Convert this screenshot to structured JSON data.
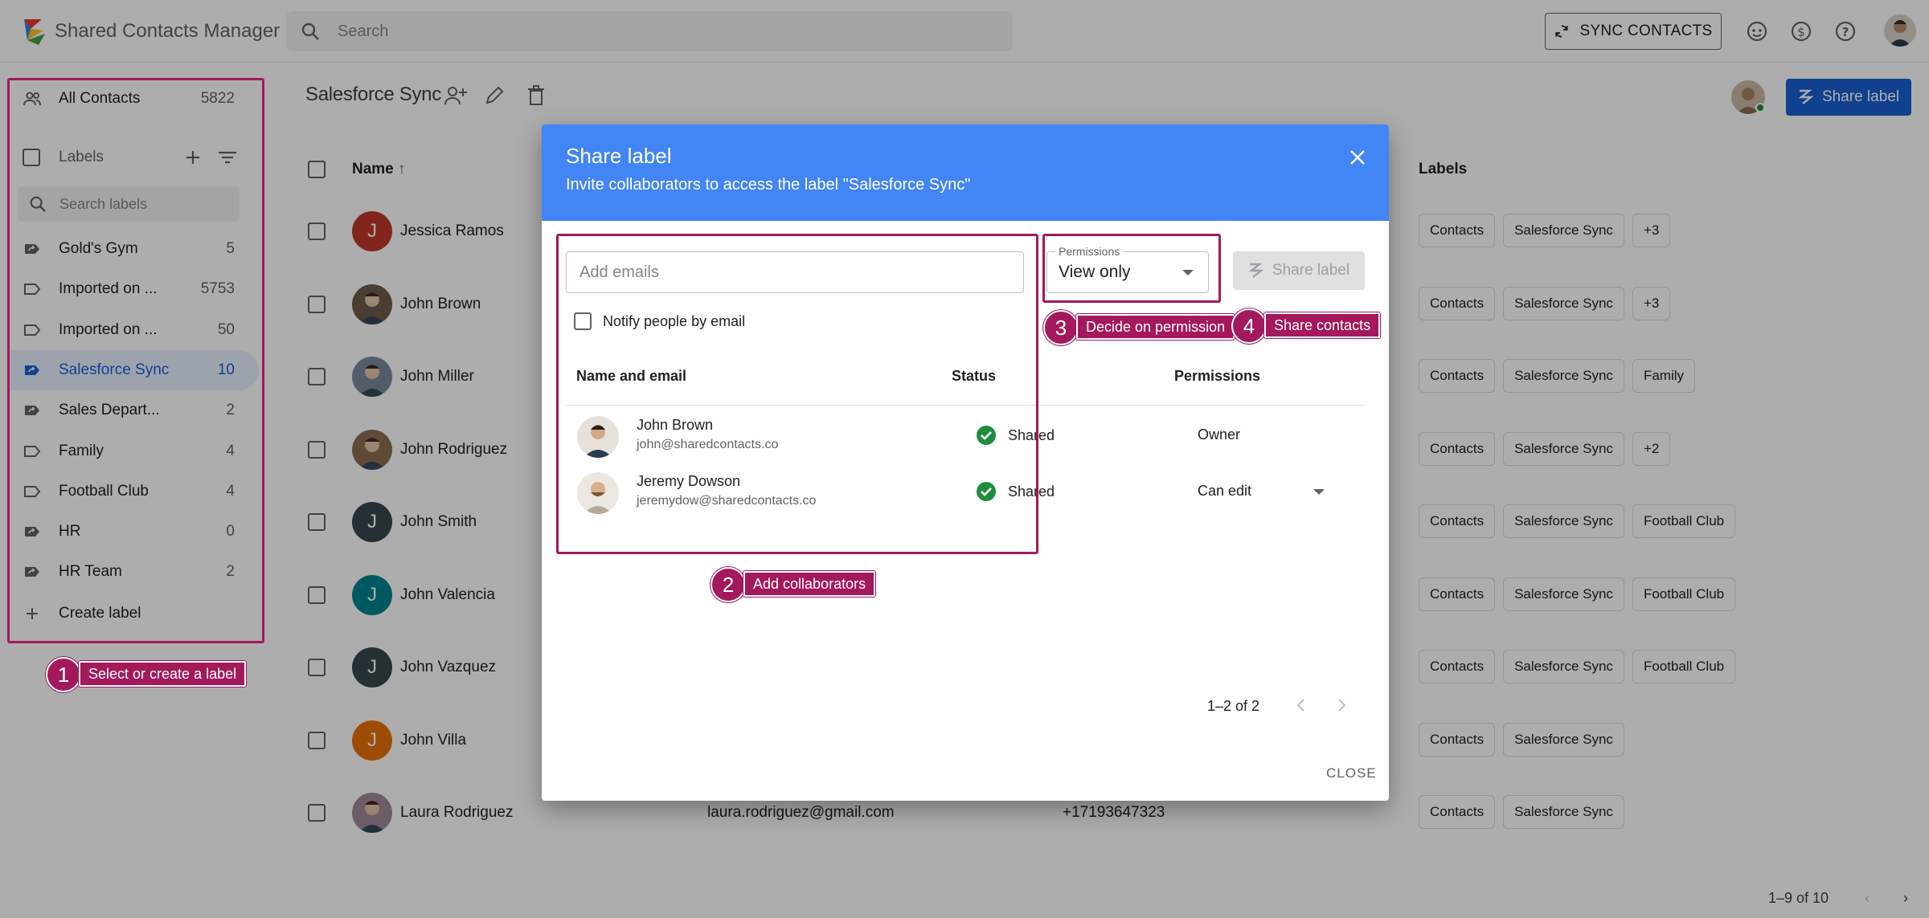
{
  "app": {
    "title": "Shared Contacts Manager"
  },
  "search": {
    "placeholder": "Search"
  },
  "toolbar": {
    "sync_label": "SYNC CONTACTS",
    "share_label": "Share label"
  },
  "sidebar": {
    "all_contacts": {
      "label": "All Contacts",
      "count": "5822"
    },
    "labels_header": "Labels",
    "label_search_placeholder": "Search labels",
    "items": [
      {
        "label": "Gold's Gym",
        "count": "5",
        "icon": "shared-label-icon"
      },
      {
        "label": "Imported on ...",
        "count": "5753",
        "icon": "label-icon"
      },
      {
        "label": "Imported on ...",
        "count": "50",
        "icon": "label-icon"
      },
      {
        "label": "Salesforce Sync",
        "count": "10",
        "icon": "shared-label-icon",
        "active": true
      },
      {
        "label": "Sales Depart...",
        "count": "2",
        "icon": "shared-label-icon"
      },
      {
        "label": "Family",
        "count": "4",
        "icon": "label-icon"
      },
      {
        "label": "Football Club",
        "count": "4",
        "icon": "label-icon"
      },
      {
        "label": "HR",
        "count": "0",
        "icon": "shared-label-icon"
      },
      {
        "label": "HR Team",
        "count": "2",
        "icon": "shared-label-icon"
      }
    ],
    "create_label": "Create label"
  },
  "main": {
    "title": "Salesforce Sync",
    "columns": {
      "name": "Name",
      "labels": "Labels"
    },
    "rows": [
      {
        "name": "Jessica Ramos",
        "initial": "J",
        "avatar_color": "#c0392b",
        "email": "",
        "phone": "",
        "labels": [
          "Contacts",
          "Salesforce Sync",
          "+3"
        ]
      },
      {
        "name": "John Brown",
        "initial": "",
        "avatar_color": "#6d5a4a",
        "email": "",
        "phone": "",
        "labels": [
          "Contacts",
          "Salesforce Sync",
          "+3"
        ]
      },
      {
        "name": "John Miller",
        "initial": "",
        "avatar_color": "#7a8aa0",
        "email": "",
        "phone": "",
        "labels": [
          "Contacts",
          "Salesforce Sync",
          "Family"
        ]
      },
      {
        "name": "John Rodriguez",
        "initial": "",
        "avatar_color": "#8d6e4e",
        "email": "",
        "phone": "",
        "labels": [
          "Contacts",
          "Salesforce Sync",
          "+2"
        ]
      },
      {
        "name": "John Smith",
        "initial": "J",
        "avatar_color": "#37474f",
        "email": "",
        "phone": "",
        "labels": [
          "Contacts",
          "Salesforce Sync",
          "Football Club"
        ]
      },
      {
        "name": "John Valencia",
        "initial": "J",
        "avatar_color": "#00838f",
        "email": "",
        "phone": "",
        "labels": [
          "Contacts",
          "Salesforce Sync",
          "Football Club"
        ]
      },
      {
        "name": "John Vazquez",
        "initial": "J",
        "avatar_color": "#37474f",
        "email": "",
        "phone": "",
        "labels": [
          "Contacts",
          "Salesforce Sync",
          "Football Club"
        ]
      },
      {
        "name": "John Villa",
        "initial": "J",
        "avatar_color": "#e8710a",
        "email": "",
        "phone": "",
        "labels": [
          "Contacts",
          "Salesforce Sync"
        ]
      },
      {
        "name": "Laura Rodriguez",
        "initial": "",
        "avatar_color": "#a08a9a",
        "email": "laura.rodriguez@gmail.com",
        "phone": "+17193647323",
        "labels": [
          "Contacts",
          "Salesforce Sync"
        ]
      }
    ],
    "pager": "1–9 of 10"
  },
  "dialog": {
    "title": "Share label",
    "subtitle": "Invite collaborators to access the label \"Salesforce Sync\"",
    "email_placeholder": "Add emails",
    "notify_label": "Notify people by email",
    "permissions_legend": "Permissions",
    "permissions_value": "View only",
    "share_button": "Share label",
    "columns": {
      "name_email": "Name and email",
      "status": "Status",
      "permissions": "Permissions"
    },
    "collaborators": [
      {
        "name": "John Brown",
        "email": "john@sharedcontacts.co",
        "status": "Shared",
        "permission": "Owner"
      },
      {
        "name": "Jeremy Dowson",
        "email": "jeremydow@sharedcontacts.co",
        "status": "Shared",
        "permission": "Can edit"
      }
    ],
    "pager": "1–2 of 2",
    "close_button": "CLOSE"
  },
  "annotations": [
    {
      "number": "1",
      "text": "Select or create a label"
    },
    {
      "number": "2",
      "text": "Add collaborators"
    },
    {
      "number": "3",
      "text": "Decide on permission"
    },
    {
      "number": "4",
      "text": "Share contacts"
    }
  ],
  "colors": {
    "accent": "#1a5fd1",
    "dialog_header": "#4285f4",
    "annotation": "#a3195b",
    "shared_ok": "#1e8e3e"
  }
}
